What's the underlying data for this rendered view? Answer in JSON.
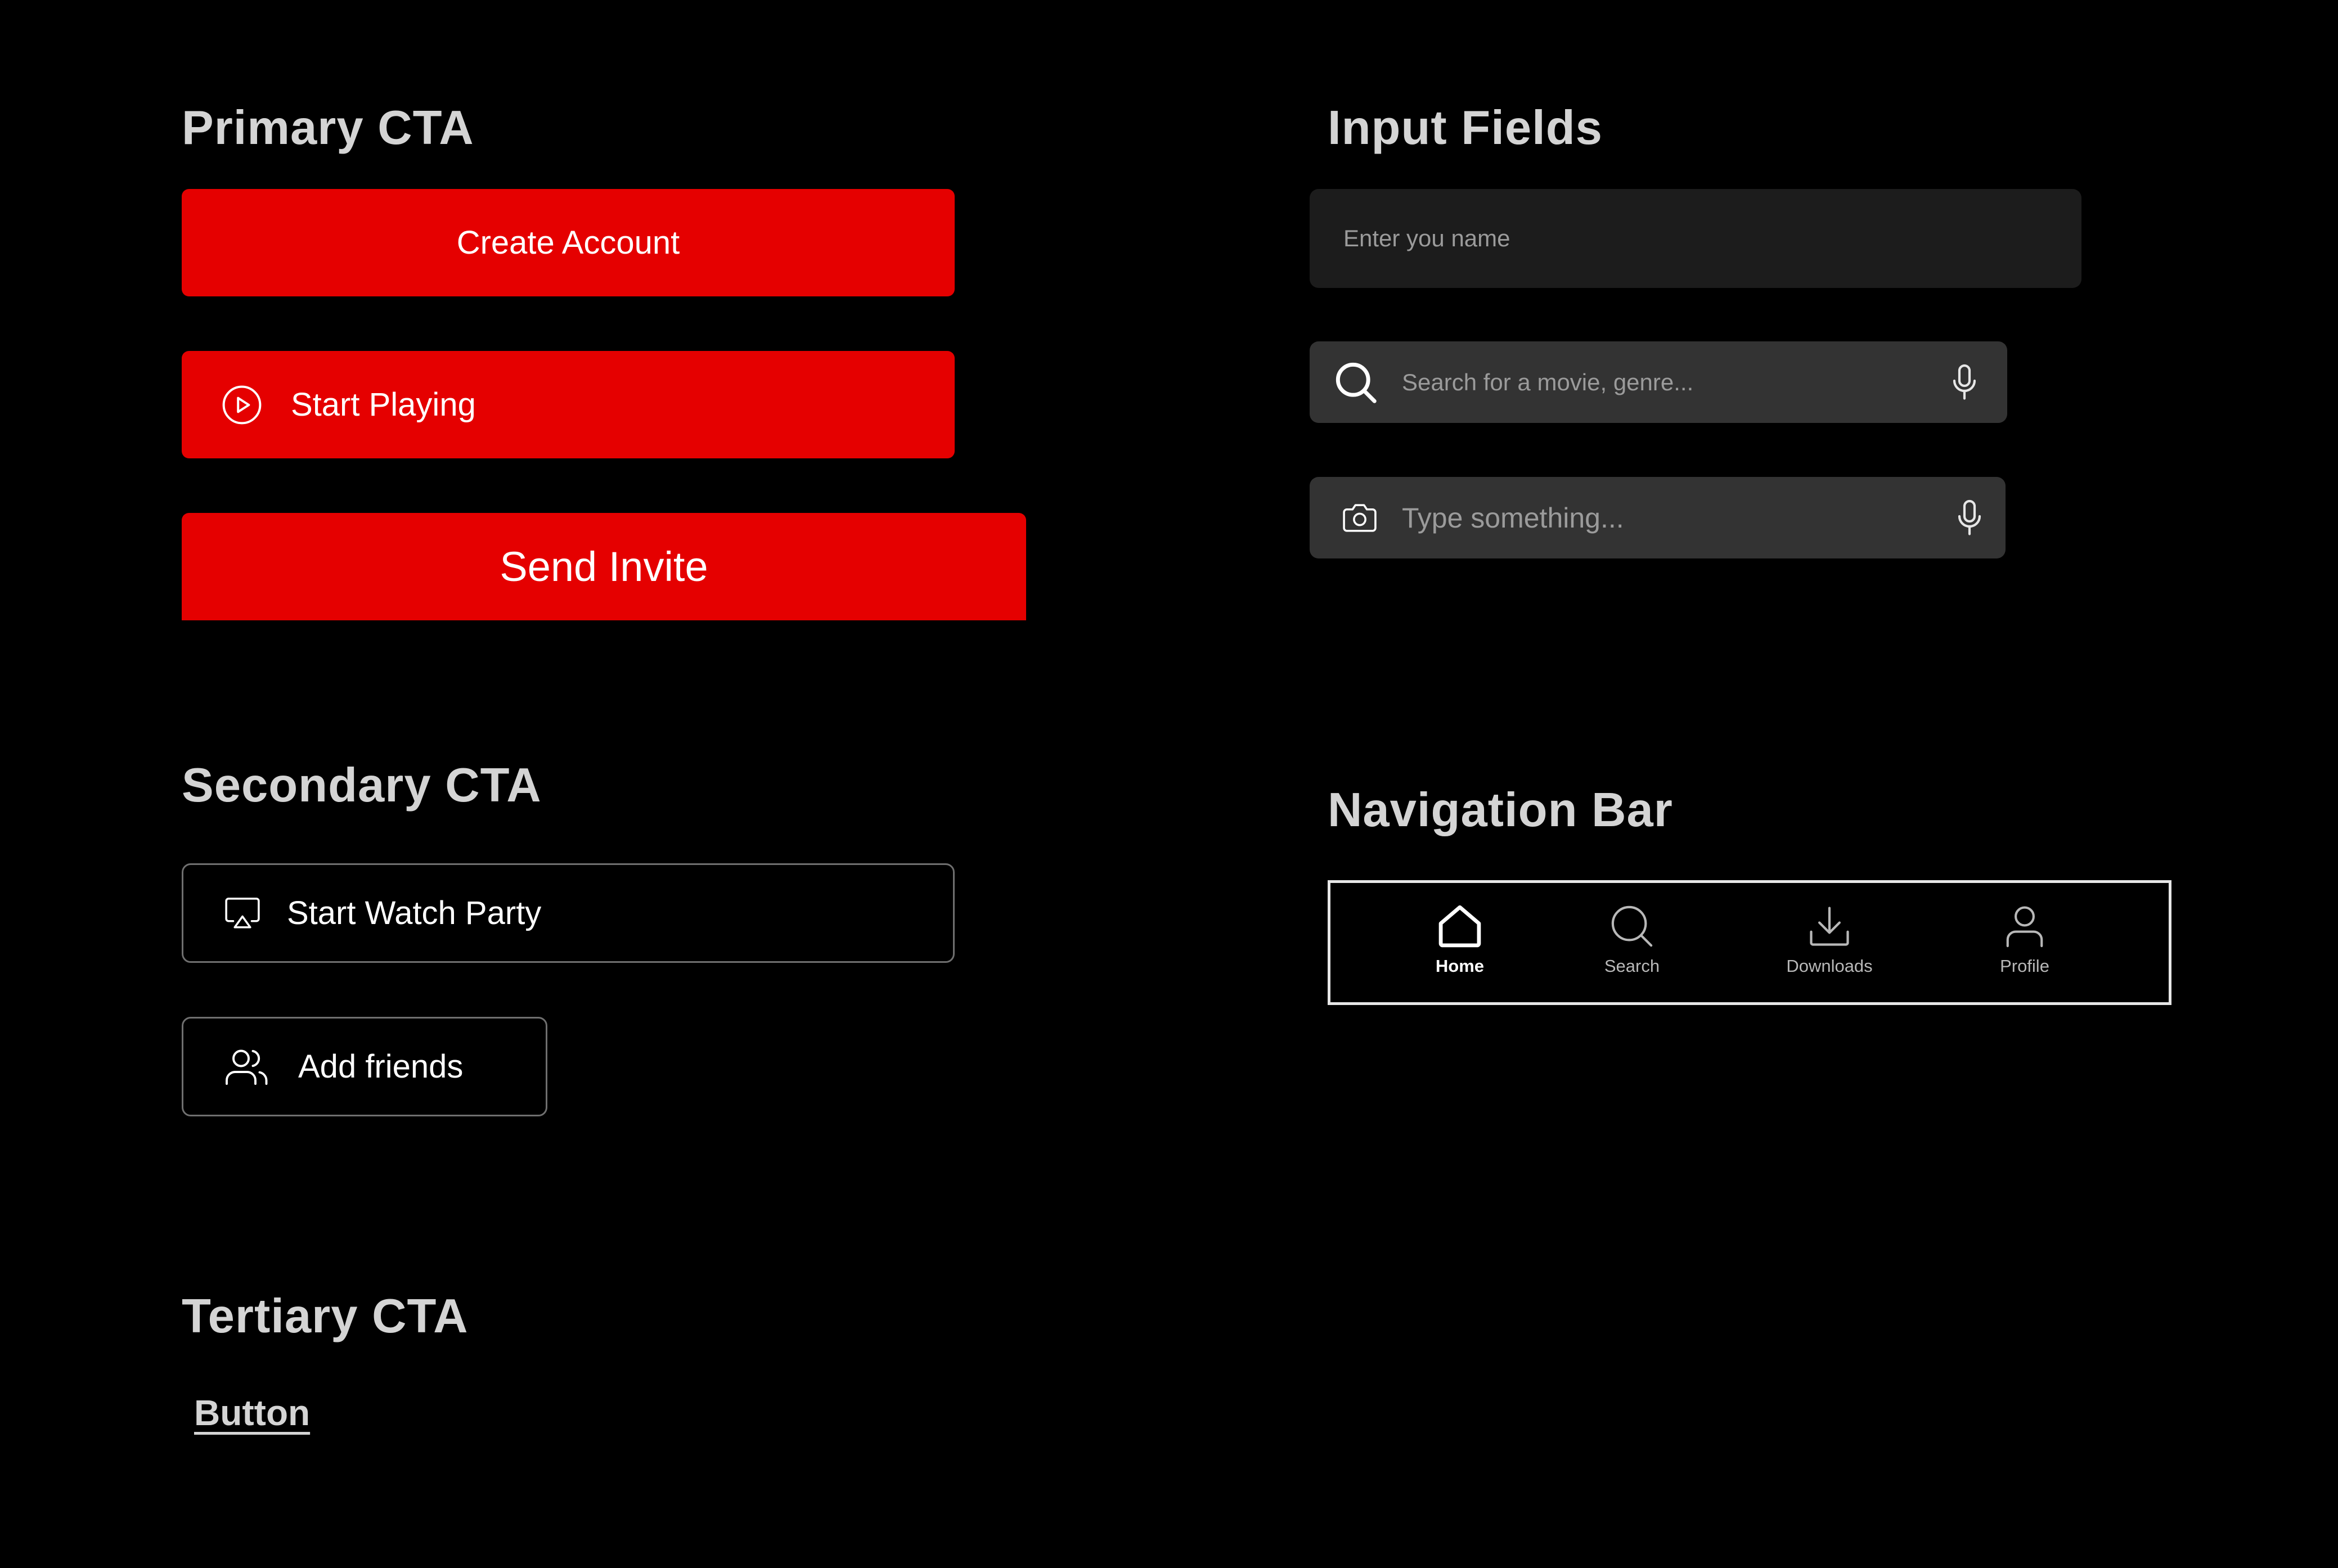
{
  "colors": {
    "background": "#000000",
    "primary_red": "#e50000",
    "title_gray": "#d4d4d4",
    "input_bg_dark": "#1c1c1c",
    "input_bg": "#333333",
    "outline_gray": "#6f6f6f"
  },
  "primary_cta": {
    "title": "Primary CTA",
    "create_account": "Create Account",
    "start_playing": "Start Playing",
    "start_playing_icon": "play-circle-icon",
    "send_invite": "Send Invite"
  },
  "secondary_cta": {
    "title": "Secondary CTA",
    "watch_party": "Start Watch Party",
    "watch_party_icon": "cast-screen-icon",
    "add_friends": "Add friends",
    "add_friends_icon": "users-icon"
  },
  "tertiary_cta": {
    "title": "Tertiary CTA",
    "button": "Button"
  },
  "input_fields": {
    "title": "Input Fields",
    "name_placeholder": "Enter you name",
    "search_placeholder": "Search for a movie, genre...",
    "search_icon": "search-icon",
    "search_mic_icon": "microphone-icon",
    "type_placeholder": "Type  something...",
    "camera_icon": "camera-icon",
    "type_mic_icon": "microphone-icon"
  },
  "navigation_bar": {
    "title": "Navigation Bar",
    "active": "Home",
    "items": [
      {
        "label": "Home",
        "icon": "home-icon"
      },
      {
        "label": "Search",
        "icon": "search-icon"
      },
      {
        "label": "Downloads",
        "icon": "download-icon"
      },
      {
        "label": "Profile",
        "icon": "user-icon"
      }
    ]
  }
}
